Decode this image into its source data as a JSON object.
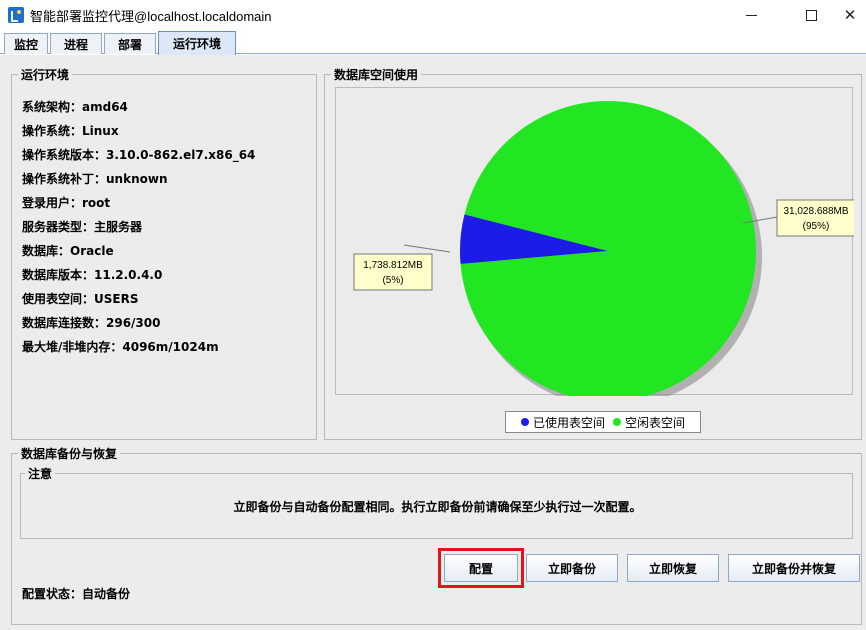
{
  "window": {
    "title": "智能部署监控代理@localhost.localdomain",
    "minimize_glyph": "—",
    "maximize_glyph": "☐",
    "close_glyph": "✕"
  },
  "tabs": [
    {
      "label": "监控",
      "active": false
    },
    {
      "label": "进程",
      "active": false
    },
    {
      "label": "部署",
      "active": false
    },
    {
      "label": "运行环境",
      "active": true
    }
  ],
  "runtime_env": {
    "title": "运行环境",
    "lines": [
      "系统架构：amd64",
      "操作系统：Linux",
      "操作系统版本：3.10.0-862.el7.x86_64",
      "操作系统补丁：unknown",
      "登录用户：root",
      "服务器类型：主服务器",
      "数据库：Oracle",
      "数据库版本：11.2.0.4.0",
      "使用表空间：USERS",
      "数据库连接数：296/300",
      "最大堆/非堆内存：4096m/1024m"
    ]
  },
  "db_space": {
    "title": "数据库空间使用",
    "legend": {
      "used": "已使用表空间",
      "free": "空闲表空间"
    }
  },
  "chart_data": {
    "type": "pie",
    "categories": [
      "已使用表空间",
      "空闲表空间"
    ],
    "values": [
      1738.812,
      31028.688
    ],
    "labels": [
      {
        "value": "1,738.812MB",
        "percent": "(5%)"
      },
      {
        "value": "31,028.688MB",
        "percent": "(95%)"
      }
    ],
    "colors": [
      "#1c1ce6",
      "#22e622"
    ],
    "legend_position": "bottom"
  },
  "backup": {
    "title": "数据库备份与恢复",
    "note_title": "注意",
    "note_text": "立即备份与自动备份配置相同。执行立即备份前请确保至少执行过一次配置。",
    "buttons": {
      "config": "配置",
      "backup_now": "立即备份",
      "restore_now": "立即恢复",
      "backup_and_restore": "立即备份并恢复"
    },
    "status": "配置状态：自动备份"
  },
  "colors": {
    "highlight": "#e0151b",
    "tab_border": "#8ea8c7"
  }
}
